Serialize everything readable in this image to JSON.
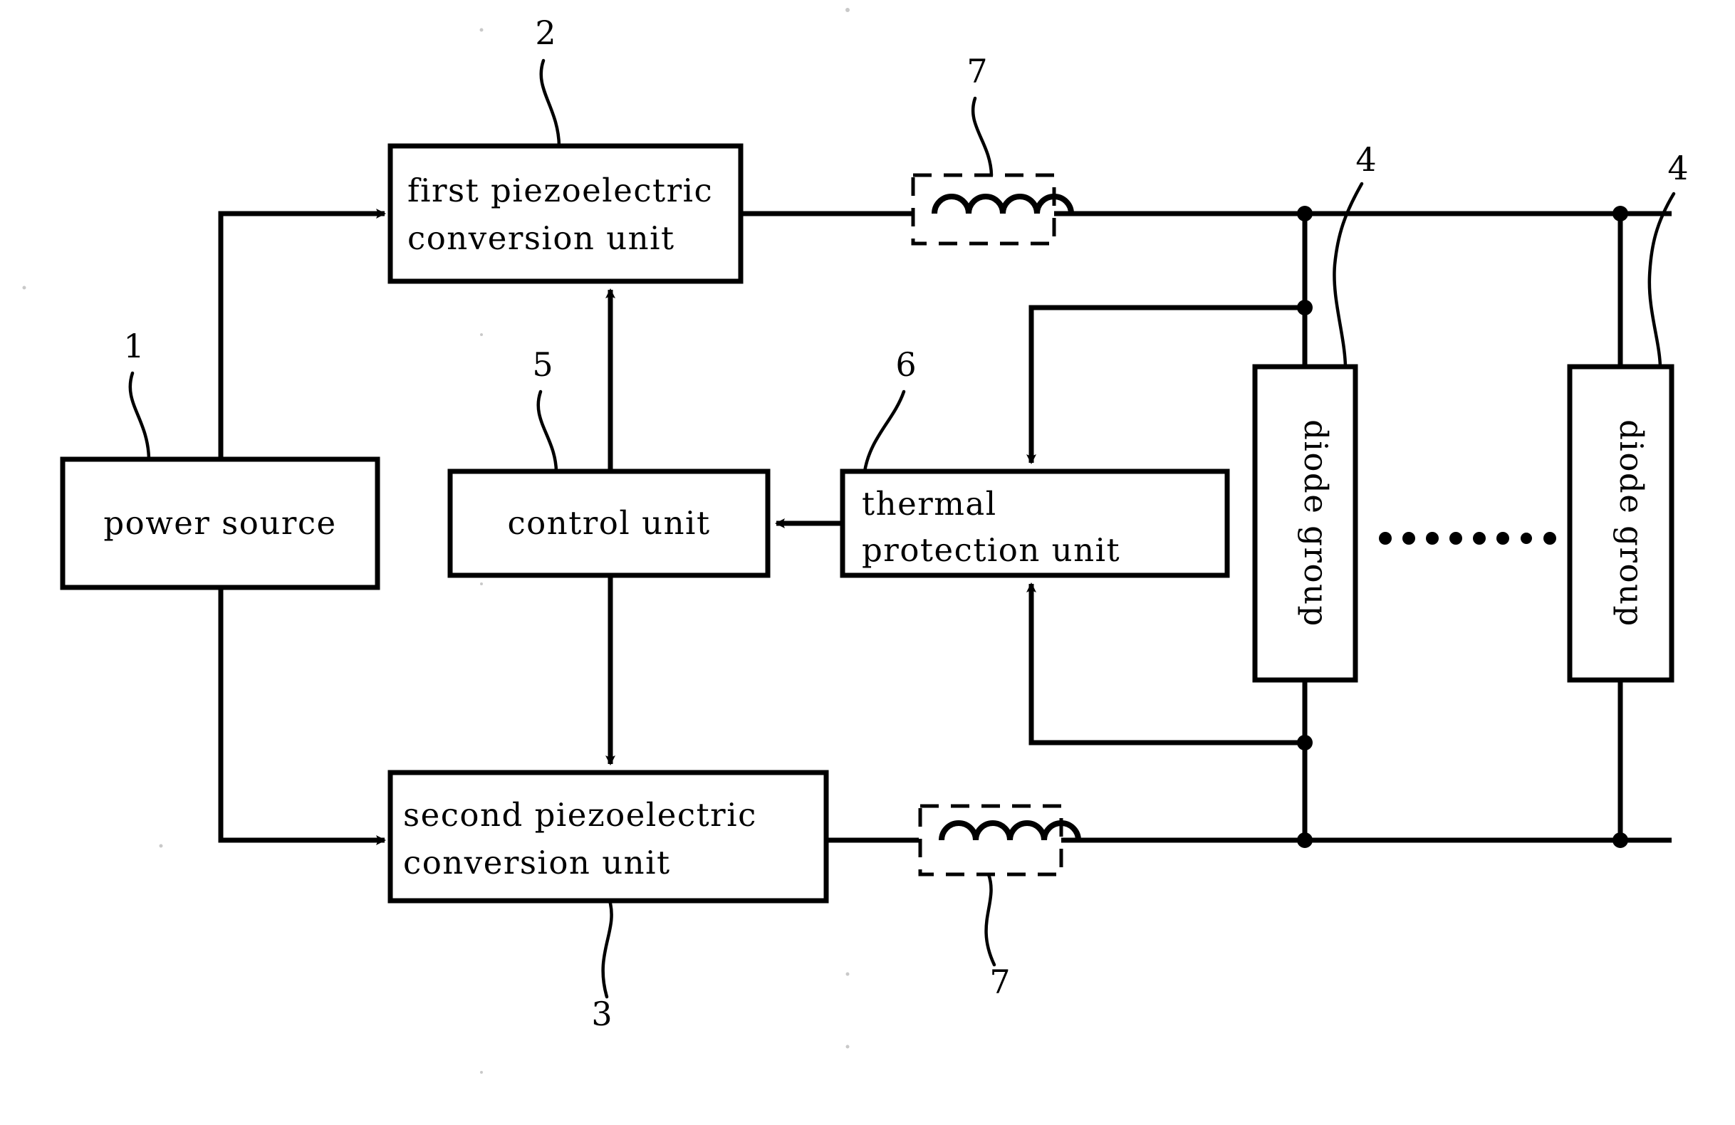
{
  "figure": {
    "kind": "patent-block-diagram",
    "background": "#ffffff",
    "ink": "#000000"
  },
  "blocks": {
    "power_source": {
      "label": "power source",
      "ref": "1"
    },
    "first_piezo": {
      "label_line1": "first piezoelectric",
      "label_line2": "conversion unit",
      "ref": "2"
    },
    "second_piezo": {
      "label_line1": "second piezoelectric",
      "label_line2": "conversion unit",
      "ref": "3"
    },
    "control_unit": {
      "label": "control unit",
      "ref": "5"
    },
    "thermal_unit": {
      "label_line1": "thermal",
      "label_line2": "protection unit",
      "ref": "6"
    },
    "diode_group_left": {
      "label": "diode group",
      "ref": "4"
    },
    "diode_group_right": {
      "label": "diode group",
      "ref": "4"
    },
    "inductor_top": {
      "ref": "7",
      "icon": "inductor-coil-icon"
    },
    "inductor_bottom": {
      "ref": "7",
      "icon": "inductor-coil-icon"
    }
  },
  "reference_numerals": {
    "n1": "1",
    "n2": "2",
    "n3": "3",
    "n4_left": "4",
    "n4_right": "4",
    "n5": "5",
    "n6": "6",
    "n7_top": "7",
    "n7_bottom": "7"
  },
  "ellipsis": {
    "name": "repeated-diode-groups-ellipsis",
    "dot_count": 8
  }
}
